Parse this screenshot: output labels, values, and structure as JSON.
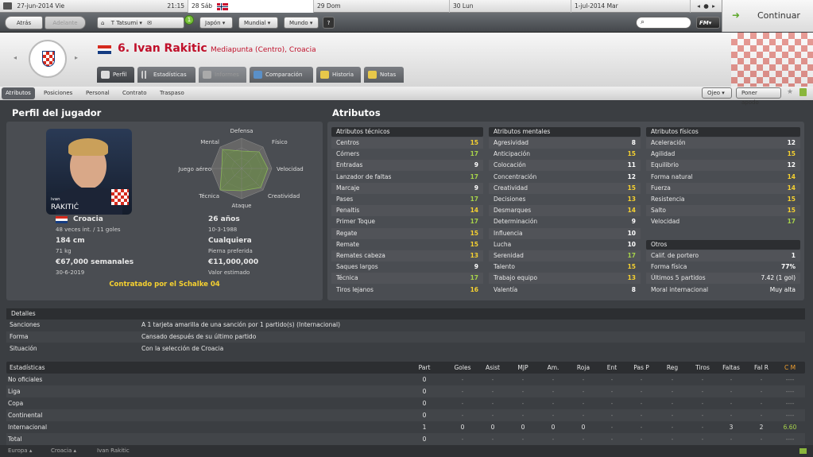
{
  "calendar": {
    "date": "27-jun-2014 Vie",
    "time": "21:15",
    "days": [
      "28 Sáb",
      "29 Dom",
      "30 Lun",
      "1-jul-2014 Mar"
    ]
  },
  "continue_label": "Continuar",
  "nav": {
    "back": "Atrás",
    "forward": "Adelante",
    "manager": "T Tatsumi",
    "menu_japan": "Japón",
    "menu_world_cup": "Mundial",
    "menu_world": "Mundo",
    "help": "?",
    "fm_menu": "FM"
  },
  "player": {
    "title": "6. Ivan Rakitic",
    "subtitle": "Mediapunta (Centro), Croacia",
    "photo_name_small": "ivan",
    "photo_name": "RAKITIĆ"
  },
  "tabs": [
    "Perfil",
    "Estadísticas",
    "Informes",
    "Comparación",
    "Historia",
    "Notas"
  ],
  "subnav": {
    "items": [
      "Atributos",
      "Posiciones",
      "Personal",
      "Contrato",
      "Traspaso"
    ],
    "scout": "Ojeo",
    "nickname": "Poner apodo"
  },
  "profile": {
    "heading": "Perfil del jugador",
    "radar_labels": [
      "Defensa",
      "Físico",
      "Velocidad",
      "Creatividad",
      "Ataque",
      "Técnica",
      "Juego aéreo",
      "Mental"
    ],
    "nation": "Croacia",
    "caps": "48 veces int. / 11 goles",
    "age": "26 años",
    "dob": "10-3-1988",
    "height": "184 cm",
    "weight": "71 kg",
    "foot": "Cualquiera",
    "foot_label": "Pierna preferida",
    "wage": "€67,000 semanales",
    "contract_end": "30-6-2019",
    "value": "€11,000,000",
    "value_label": "Valor estimado",
    "contracted": "Contratado por el Schalke 04"
  },
  "attributes": {
    "heading": "Atributos",
    "technical": {
      "title": "Atributos técnicos",
      "rows": [
        [
          "Centros",
          "15"
        ],
        [
          "Córners",
          "17"
        ],
        [
          "Entradas",
          "9"
        ],
        [
          "Lanzador de faltas",
          "17"
        ],
        [
          "Marcaje",
          "9"
        ],
        [
          "Pases",
          "17"
        ],
        [
          "Penaltis",
          "14"
        ],
        [
          "Primer Toque",
          "17"
        ],
        [
          "Regate",
          "15"
        ],
        [
          "Remate",
          "15"
        ],
        [
          "Remates cabeza",
          "13"
        ],
        [
          "Saques largos",
          "9"
        ],
        [
          "Técnica",
          "17"
        ],
        [
          "Tiros lejanos",
          "16"
        ]
      ]
    },
    "mental": {
      "title": "Atributos mentales",
      "rows": [
        [
          "Agresividad",
          "8"
        ],
        [
          "Anticipación",
          "15"
        ],
        [
          "Colocación",
          "11"
        ],
        [
          "Concentración",
          "12"
        ],
        [
          "Creatividad",
          "15"
        ],
        [
          "Decisiones",
          "13"
        ],
        [
          "Desmarques",
          "14"
        ],
        [
          "Determinación",
          "9"
        ],
        [
          "Influencia",
          "10"
        ],
        [
          "Lucha",
          "10"
        ],
        [
          "Serenidad",
          "17"
        ],
        [
          "Talento",
          "15"
        ],
        [
          "Trabajo equipo",
          "13"
        ],
        [
          "Valentía",
          "8"
        ]
      ]
    },
    "physical": {
      "title": "Atributos físicos",
      "rows": [
        [
          "Aceleración",
          "12"
        ],
        [
          "Agilidad",
          "15"
        ],
        [
          "Equilibrio",
          "12"
        ],
        [
          "Forma natural",
          "14"
        ],
        [
          "Fuerza",
          "14"
        ],
        [
          "Resistencia",
          "15"
        ],
        [
          "Salto",
          "15"
        ],
        [
          "Velocidad",
          "17"
        ]
      ]
    },
    "other": {
      "title": "Otros",
      "rows": [
        [
          "Calif. de portero",
          "1"
        ],
        [
          "Forma física",
          "77%"
        ],
        [
          "Últimos 5 partidos",
          "7.42 (1 gol)"
        ],
        [
          "Moral internacional",
          "Muy alta"
        ]
      ]
    }
  },
  "details": {
    "title": "Detalles",
    "rows": [
      [
        "Sanciones",
        "A 1 tarjeta amarilla de una sanción por 1 partido(s) (Internacional)"
      ],
      [
        "Forma",
        "Cansado después de su último partido"
      ],
      [
        "Situación",
        "Con la selección de Croacia"
      ]
    ]
  },
  "stats": {
    "title": "Estadísticas",
    "columns": [
      "Part",
      "Goles",
      "Asist",
      "MJP",
      "Am.",
      "Roja",
      "Ent",
      "Pas P",
      "Reg",
      "Tiros",
      "Faltas",
      "Fal R",
      "C M"
    ],
    "rows": [
      {
        "label": "No oficiales",
        "cells": [
          "0",
          "-",
          "-",
          "-",
          "-",
          "-",
          "-",
          "-",
          "-",
          "-",
          "-",
          "-",
          "----"
        ]
      },
      {
        "label": "Liga",
        "cells": [
          "0",
          "-",
          "-",
          "-",
          "-",
          "-",
          "-",
          "-",
          "-",
          "-",
          "-",
          "-",
          "----"
        ]
      },
      {
        "label": "Copa",
        "cells": [
          "0",
          "-",
          "-",
          "-",
          "-",
          "-",
          "-",
          "-",
          "-",
          "-",
          "-",
          "-",
          "----"
        ]
      },
      {
        "label": "Continental",
        "cells": [
          "0",
          "-",
          "-",
          "-",
          "-",
          "-",
          "-",
          "-",
          "-",
          "-",
          "-",
          "-",
          "----"
        ]
      },
      {
        "label": "Internacional",
        "cells": [
          "1",
          "0",
          "0",
          "0",
          "0",
          "0",
          "-",
          "-",
          "-",
          "-",
          "3",
          "2",
          "6.60"
        ]
      },
      {
        "label": "Total",
        "cells": [
          "0",
          "-",
          "-",
          "-",
          "-",
          "-",
          "-",
          "-",
          "-",
          "-",
          "-",
          "-",
          "----"
        ]
      }
    ]
  },
  "footer": [
    "Europa",
    "Croacia",
    "Ivan Rakitic"
  ]
}
